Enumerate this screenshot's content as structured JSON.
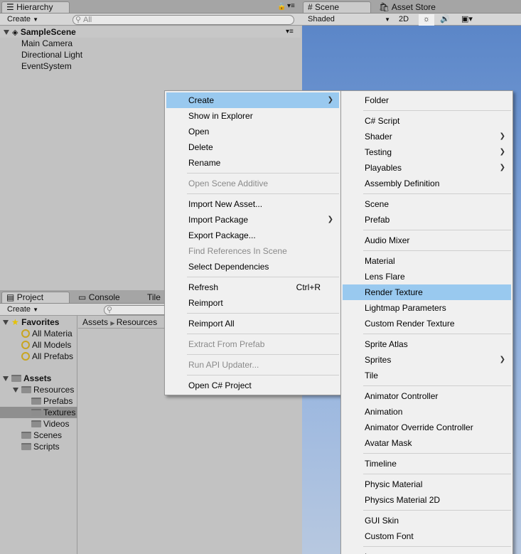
{
  "hierarchy": {
    "tab": "Hierarchy",
    "create": "Create",
    "search_placeholder": "All",
    "scene_name": "SampleScene",
    "items": [
      "Main Camera",
      "Directional Light",
      "EventSystem"
    ]
  },
  "scene": {
    "tabs": [
      "Scene",
      "Asset Store"
    ],
    "shading": "Shaded",
    "mode_2d": "2D"
  },
  "project": {
    "tabs": [
      "Project",
      "Console",
      "Tile"
    ],
    "create": "Create",
    "favorites_label": "Favorites",
    "favorites": [
      "All Materia",
      "All Models",
      "All Prefabs"
    ],
    "assets_label": "Assets",
    "resources_label": "Resources",
    "resources_children": [
      "Prefabs",
      "Textures",
      "Videos"
    ],
    "assets_children": [
      "Scenes",
      "Scripts"
    ],
    "breadcrumb": [
      "Assets",
      "Resources"
    ]
  },
  "context_menu": {
    "items": [
      {
        "label": "Create",
        "submenu": true,
        "highlight": true
      },
      {
        "label": "Show in Explorer"
      },
      {
        "label": "Open"
      },
      {
        "label": "Delete"
      },
      {
        "label": "Rename"
      },
      {
        "sep": true
      },
      {
        "label": "Open Scene Additive",
        "disabled": true
      },
      {
        "sep": true
      },
      {
        "label": "Import New Asset..."
      },
      {
        "label": "Import Package",
        "submenu": true
      },
      {
        "label": "Export Package..."
      },
      {
        "label": "Find References In Scene",
        "disabled": true
      },
      {
        "label": "Select Dependencies"
      },
      {
        "sep": true
      },
      {
        "label": "Refresh",
        "shortcut": "Ctrl+R"
      },
      {
        "label": "Reimport"
      },
      {
        "sep": true
      },
      {
        "label": "Reimport All"
      },
      {
        "sep": true
      },
      {
        "label": "Extract From Prefab",
        "disabled": true
      },
      {
        "sep": true
      },
      {
        "label": "Run API Updater...",
        "disabled": true
      },
      {
        "sep": true
      },
      {
        "label": "Open C# Project"
      }
    ]
  },
  "create_submenu": {
    "items": [
      {
        "label": "Folder"
      },
      {
        "sep": true
      },
      {
        "label": "C# Script"
      },
      {
        "label": "Shader",
        "submenu": true
      },
      {
        "label": "Testing",
        "submenu": true
      },
      {
        "label": "Playables",
        "submenu": true
      },
      {
        "label": "Assembly Definition"
      },
      {
        "sep": true
      },
      {
        "label": "Scene"
      },
      {
        "label": "Prefab"
      },
      {
        "sep": true
      },
      {
        "label": "Audio Mixer"
      },
      {
        "sep": true
      },
      {
        "label": "Material"
      },
      {
        "label": "Lens Flare"
      },
      {
        "label": "Render Texture",
        "highlight": true
      },
      {
        "label": "Lightmap Parameters"
      },
      {
        "label": "Custom Render Texture"
      },
      {
        "sep": true
      },
      {
        "label": "Sprite Atlas"
      },
      {
        "label": "Sprites",
        "submenu": true
      },
      {
        "label": "Tile"
      },
      {
        "sep": true
      },
      {
        "label": "Animator Controller"
      },
      {
        "label": "Animation"
      },
      {
        "label": "Animator Override Controller"
      },
      {
        "label": "Avatar Mask"
      },
      {
        "sep": true
      },
      {
        "label": "Timeline"
      },
      {
        "sep": true
      },
      {
        "label": "Physic Material"
      },
      {
        "label": "Physics Material 2D"
      },
      {
        "sep": true
      },
      {
        "label": "GUI Skin"
      },
      {
        "label": "Custom Font"
      },
      {
        "sep": true
      },
      {
        "label": "L"
      }
    ]
  },
  "colors": {
    "menu_highlight": "#99c9ef",
    "selection": "#8f8f8f",
    "sky_top": "#5b86c8",
    "sky_bottom": "#a9c0df"
  }
}
